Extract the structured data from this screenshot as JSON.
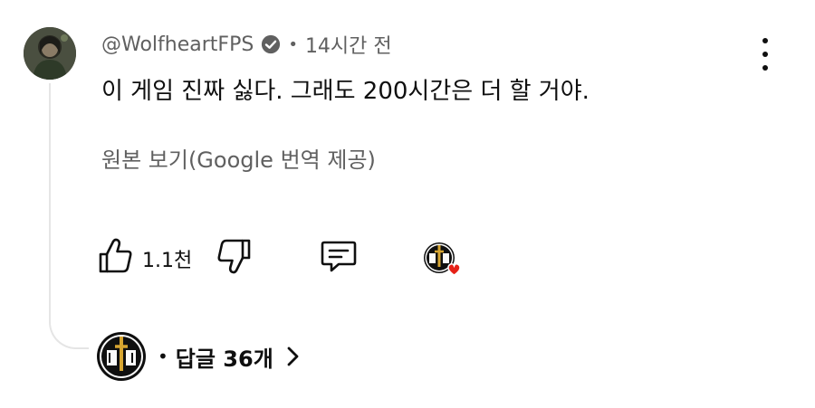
{
  "comment": {
    "author_handle": "@WolfheartFPS",
    "verified_icon": "verified-check-icon",
    "separator": "•",
    "timestamp": "14시간 전",
    "text": "이 게임 진짜 싫다. 그래도 200시간은 더 할 거야.",
    "translation_link": "원본 보기(Google 번역 제공)"
  },
  "actions": {
    "like_icon": "thumbs-up-icon",
    "like_count": "1.1천",
    "dislike_icon": "thumbs-down-icon",
    "reply_icon": "reply-comment-icon",
    "creator_heart_icon": "creator-heart-icon",
    "menu_icon": "more-vert-icon"
  },
  "replies": {
    "separator": "•",
    "label": "답글 36개",
    "chevron_icon": "chevron-right-icon"
  },
  "colors": {
    "text_primary": "#0f0f0f",
    "text_secondary": "#606060",
    "heart": "#e62117",
    "thread_line": "#e5e5e5"
  }
}
